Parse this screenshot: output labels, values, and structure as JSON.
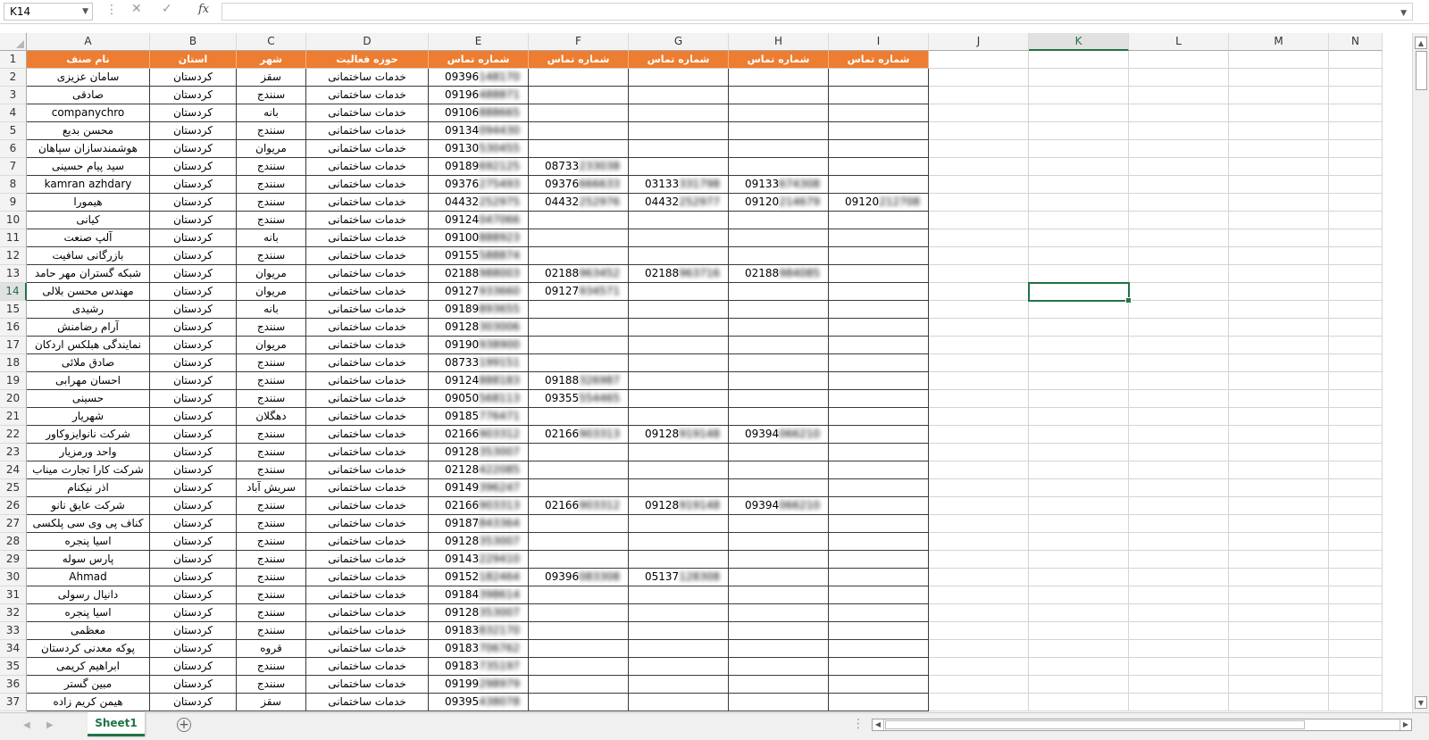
{
  "formula_bar": {
    "name_box": "K14",
    "formula": ""
  },
  "columns": [
    "A",
    "B",
    "C",
    "D",
    "E",
    "F",
    "G",
    "H",
    "I",
    "J",
    "K",
    "L",
    "M",
    "N"
  ],
  "selected_cell": "K14",
  "header_row": [
    "نام صنف",
    "استان",
    "شهر",
    "حوزه فعالیت",
    "شماره تماس",
    "شماره تماس",
    "شماره تماس",
    "شماره تماس",
    "شماره تماس"
  ],
  "rows": [
    [
      "سامان عزیزی",
      "کردستان",
      "سقز",
      "خدمات ساختمانی",
      "09396148170",
      "",
      "",
      "",
      ""
    ],
    [
      "صادقی",
      "کردستان",
      "سنندج",
      "خدمات ساختمانی",
      "09196488871",
      "",
      "",
      "",
      ""
    ],
    [
      "companychro",
      "کردستان",
      "بانه",
      "خدمات ساختمانی",
      "09106888665",
      "",
      "",
      "",
      ""
    ],
    [
      "محسن بدیع",
      "کردستان",
      "سنندج",
      "خدمات ساختمانی",
      "09134094430",
      "",
      "",
      "",
      ""
    ],
    [
      "هوشمندسازان سپاهان",
      "کردستان",
      "مریوان",
      "خدمات ساختمانی",
      "09130530455",
      "",
      "",
      "",
      ""
    ],
    [
      "سید پیام حسینی",
      "کردستان",
      "سنندج",
      "خدمات ساختمانی",
      "09189692125",
      "08733233038",
      "",
      "",
      ""
    ],
    [
      "kamran azhdary",
      "کردستان",
      "سنندج",
      "خدمات ساختمانی",
      "09376275493",
      "09376666633",
      "03133331798",
      "09133674308",
      ""
    ],
    [
      "هیمورا",
      "کردستان",
      "سنندج",
      "خدمات ساختمانی",
      "04432252975",
      "04432252976",
      "04432252977",
      "09120214679",
      "09120212708"
    ],
    [
      "کیانی",
      "کردستان",
      "سنندج",
      "خدمات ساختمانی",
      "09124047066",
      "",
      "",
      "",
      ""
    ],
    [
      "آلپ صنعت",
      "کردستان",
      "بانه",
      "خدمات ساختمانی",
      "09100888923",
      "",
      "",
      "",
      ""
    ],
    [
      "بازرگانی سافیت",
      "کردستان",
      "سنندج",
      "خدمات ساختمانی",
      "09155588874",
      "",
      "",
      "",
      ""
    ],
    [
      "شبکه گستران مهر حامد",
      "کردستان",
      "مریوان",
      "خدمات ساختمانی",
      "02188988003",
      "02188963452",
      "02188963716",
      "02188984085",
      ""
    ],
    [
      "مهندس محسن بلالی",
      "کردستان",
      "مریوان",
      "خدمات ساختمانی",
      "09127933660",
      "09127934571",
      "",
      "",
      ""
    ],
    [
      "رشیدی",
      "کردستان",
      "بانه",
      "خدمات ساختمانی",
      "09189893655",
      "",
      "",
      "",
      ""
    ],
    [
      "آرام رضامنش",
      "کردستان",
      "سنندج",
      "خدمات ساختمانی",
      "09128303006",
      "",
      "",
      "",
      ""
    ],
    [
      "نمایندگی هبلکس اردکان",
      "کردستان",
      "مریوان",
      "خدمات ساختمانی",
      "09190938900",
      "",
      "",
      "",
      ""
    ],
    [
      "صادق ملائی",
      "کردستان",
      "سنندج",
      "خدمات ساختمانی",
      "08733199151",
      "",
      "",
      "",
      ""
    ],
    [
      "احسان مهرابی",
      "کردستان",
      "سنندج",
      "خدمات ساختمانی",
      "09124888183",
      "09188326987",
      "",
      "",
      ""
    ],
    [
      "حسینی",
      "کردستان",
      "سنندج",
      "خدمات ساختمانی",
      "09050568113",
      "09355554465",
      "",
      "",
      ""
    ],
    [
      "شهریار",
      "کردستان",
      "دهگلان",
      "خدمات ساختمانی",
      "09185776471",
      "",
      "",
      "",
      ""
    ],
    [
      "شرکت نانوایزوکاور",
      "کردستان",
      "سنندج",
      "خدمات ساختمانی",
      "02166903312",
      "02166903313",
      "09128919148",
      "09394066210",
      ""
    ],
    [
      "واحد ورمزیار",
      "کردستان",
      "سنندج",
      "خدمات ساختمانی",
      "09128353007",
      "",
      "",
      "",
      ""
    ],
    [
      "شرکت کارا تجارت میناب",
      "کردستان",
      "سنندج",
      "خدمات ساختمانی",
      "02128422085",
      "",
      "",
      "",
      ""
    ],
    [
      "اذر نیکنام",
      "کردستان",
      "سریش آباد",
      "خدمات ساختمانی",
      "09149396247",
      "",
      "",
      "",
      ""
    ],
    [
      "شرکت عایق نانو",
      "کردستان",
      "سنندج",
      "خدمات ساختمانی",
      "02166903313",
      "02166903312",
      "09128919148",
      "09394066210",
      ""
    ],
    [
      "کناف پی وی سی پلکسی",
      "کردستان",
      "سنندج",
      "خدمات ساختمانی",
      "09187843364",
      "",
      "",
      "",
      ""
    ],
    [
      "اسیا پنجره",
      "کردستان",
      "سنندج",
      "خدمات ساختمانی",
      "09128353007",
      "",
      "",
      "",
      ""
    ],
    [
      "پارس سوله",
      "کردستان",
      "سنندج",
      "خدمات ساختمانی",
      "09143229410",
      "",
      "",
      "",
      ""
    ],
    [
      "Ahmad",
      "کردستان",
      "سنندج",
      "خدمات ساختمانی",
      "09152182464",
      "09396083308",
      "05137128308",
      "",
      ""
    ],
    [
      "دانیال رسولی",
      "کردستان",
      "سنندج",
      "خدمات ساختمانی",
      "09184398614",
      "",
      "",
      "",
      ""
    ],
    [
      "اسیا پنجره",
      "کردستان",
      "سنندج",
      "خدمات ساختمانی",
      "09128353007",
      "",
      "",
      "",
      ""
    ],
    [
      "معظمی",
      "کردستان",
      "سنندج",
      "خدمات ساختمانی",
      "09183832170",
      "",
      "",
      "",
      ""
    ],
    [
      "پوکه معدنی کردستان",
      "کردستان",
      "قروه",
      "خدمات ساختمانی",
      "09183706762",
      "",
      "",
      "",
      ""
    ],
    [
      "ابراهیم کریمی",
      "کردستان",
      "سنندج",
      "خدمات ساختمانی",
      "09183735197",
      "",
      "",
      "",
      ""
    ],
    [
      "مبین گستر",
      "کردستان",
      "سنندج",
      "خدمات ساختمانی",
      "09199298979",
      "",
      "",
      "",
      ""
    ],
    [
      "هیمن کریم زاده",
      "کردستان",
      "سقز",
      "خدمات ساختمانی",
      "09395438078",
      "",
      "",
      "",
      ""
    ]
  ],
  "sheet_tab": "Sheet1",
  "icons": {
    "cancel": "close-icon",
    "enter": "check-icon",
    "function": "fx-icon",
    "add_sheet": "plus-circle-icon"
  },
  "colors": {
    "header_fill": "#ed7d31",
    "selection": "#217346"
  }
}
